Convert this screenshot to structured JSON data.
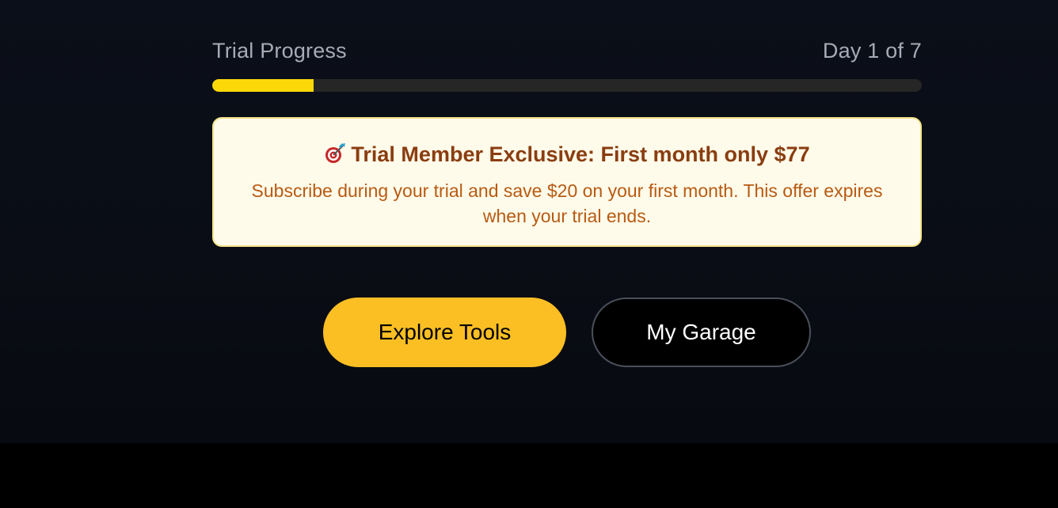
{
  "trial": {
    "label": "Trial Progress",
    "day_text": "Day 1 of 7",
    "progress_fraction": 0.143,
    "track_color": "#262626",
    "fill_color": "#fcd808"
  },
  "offer": {
    "icon": "target-dart-icon",
    "title": "Trial Member Exclusive: First month only $77",
    "body": "Subscribe during your trial and save $20 on your first month. This offer expires when your trial ends.",
    "background_color": "#fefbea",
    "border_color": "#f4e38a",
    "title_color": "#8a3d10",
    "body_color": "#b85a12"
  },
  "actions": {
    "primary_label": "Explore Tools",
    "secondary_label": "My Garage",
    "primary_color": "#fbbf24"
  }
}
